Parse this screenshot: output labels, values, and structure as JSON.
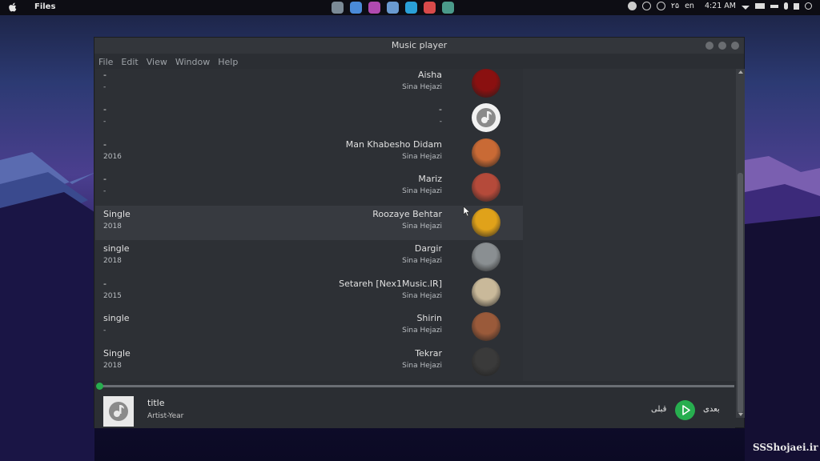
{
  "topbar": {
    "files_label": "Files",
    "lang": "en",
    "date_fa": "۲۵",
    "time": "4:21 AM"
  },
  "window": {
    "title": "Music player",
    "menu": [
      "File",
      "Edit",
      "View",
      "Window",
      "Help"
    ]
  },
  "tracks": [
    {
      "left_top": "-",
      "left_bottom": "-",
      "title": "Aisha",
      "artist": "Sina Hejazi",
      "art_color": "#8a1010"
    },
    {
      "left_top": "-",
      "left_bottom": "-",
      "title": "-",
      "artist": "-",
      "art_color": "#f2f2f2"
    },
    {
      "left_top": "-",
      "left_bottom": "2016",
      "title": "Man Khabesho Didam",
      "artist": "Sina Hejazi",
      "art_color": "#c96a35"
    },
    {
      "left_top": "-",
      "left_bottom": "-",
      "title": "Mariz",
      "artist": "Sina Hejazi",
      "art_color": "#b54a3a"
    },
    {
      "left_top": "Single",
      "left_bottom": "2018",
      "title": "Roozaye Behtar",
      "artist": "Sina Hejazi",
      "art_color": "#e0a21a"
    },
    {
      "left_top": "single",
      "left_bottom": "2018",
      "title": "Dargir",
      "artist": "Sina Hejazi",
      "art_color": "#8a8f92"
    },
    {
      "left_top": "-",
      "left_bottom": "2015",
      "title": "Setareh [Nex1Music.IR]",
      "artist": "Sina Hejazi",
      "art_color": "#c9b99a"
    },
    {
      "left_top": "single",
      "left_bottom": "-",
      "title": "Shirin",
      "artist": "Sina Hejazi",
      "art_color": "#9a5a3a"
    },
    {
      "left_top": "Single",
      "left_bottom": "2018",
      "title": "Tekrar",
      "artist": "Sina Hejazi",
      "art_color": "#3a3a3a"
    }
  ],
  "player": {
    "title": "title",
    "meta": "Artist-Year",
    "prev_label": "قبلی",
    "next_label": "بعدی",
    "accent": "#27ae4f",
    "progress": 0
  },
  "watermark": "SSShojaei.ir"
}
